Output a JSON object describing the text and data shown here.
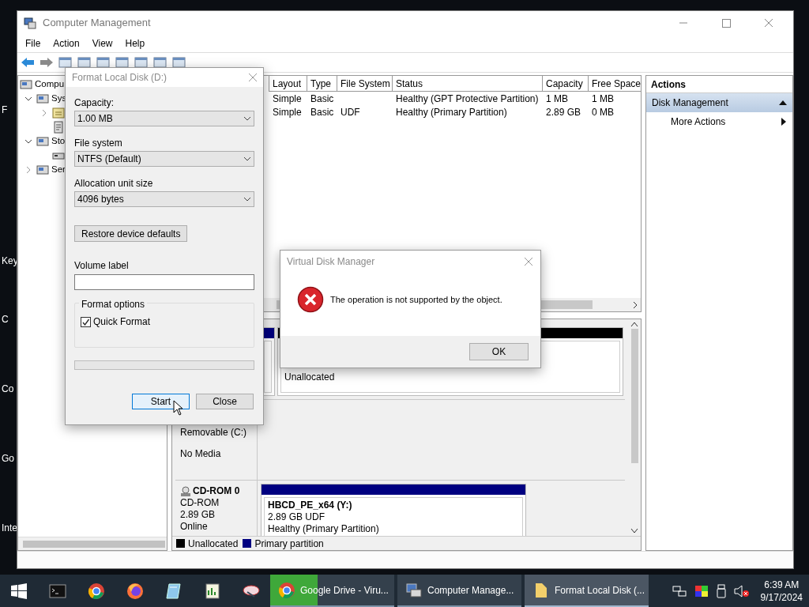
{
  "desktop_labels": [
    "F",
    "Key",
    "C",
    "Co",
    "Go",
    "Inte"
  ],
  "main_window": {
    "title": "Computer Management",
    "menu": [
      "File",
      "Action",
      "View",
      "Help"
    ],
    "tree": [
      {
        "label": "Compu",
        "children": [
          {
            "label": "Sys",
            "expanded": true,
            "children": [
              {
                "kind": "scheduler",
                "expanded": false
              },
              {
                "kind": "viewer"
              }
            ]
          },
          {
            "label": "Sto",
            "expanded": true,
            "children": [
              {
                "kind": "disk"
              }
            ]
          },
          {
            "label": "Ser",
            "expanded": false
          }
        ]
      }
    ],
    "table": {
      "columns": [
        "Layout",
        "Type",
        "File System",
        "Status",
        "Capacity",
        "Free Space"
      ],
      "rows": [
        [
          "Simple",
          "Basic",
          "",
          "Healthy (GPT Protective Partition)",
          "1 MB",
          "1 MB"
        ],
        [
          "Simple",
          "Basic",
          "UDF",
          "Healthy (Primary Partition)",
          "2.89 GB",
          "0 MB"
        ]
      ]
    },
    "disks": [
      {
        "partitions": [
          {
            "kind": "primary"
          },
          {
            "kind": "unallocated",
            "lines": [
              "Unallocated"
            ]
          }
        ]
      },
      {
        "lines": [
          "Removable (C:)",
          "No Media"
        ]
      },
      {
        "name": "CD-ROM 0",
        "lines": [
          "CD-ROM",
          "2.89 GB",
          "Online"
        ],
        "partitions": [
          {
            "kind": "primary",
            "title": "HBCD_PE_x64  (Y:)",
            "lines": [
              "2.89 GB UDF",
              "Healthy (Primary Partition)"
            ]
          }
        ]
      }
    ],
    "legend": [
      {
        "label": "Unallocated",
        "color": "#000000"
      },
      {
        "label": "Primary partition",
        "color": "#000080"
      }
    ],
    "actions": {
      "title": "Actions",
      "items": [
        {
          "label": "Disk Management",
          "kind": "section",
          "selected": true
        },
        {
          "label": "More Actions",
          "kind": "submenu",
          "selected": false
        }
      ]
    }
  },
  "format_dialog": {
    "title": "Format Local Disk (D:)",
    "fields": [
      {
        "label": "Capacity:",
        "value": "1.00 MB"
      },
      {
        "label": "File system",
        "value": "NTFS (Default)"
      },
      {
        "label": "Allocation unit size",
        "value": "4096 bytes"
      }
    ],
    "restore_button": "Restore device defaults",
    "volume_label": "Volume label",
    "options_title": "Format options",
    "quick_format": {
      "label": "Quick Format",
      "checked": true
    },
    "progress": {
      "level": 0
    },
    "buttons": [
      {
        "label": "Start",
        "default": true
      },
      {
        "label": "Close",
        "default": false
      }
    ]
  },
  "message_dialog": {
    "title": "Virtual Disk Manager",
    "message": "The operation is not supported by the object.",
    "button": "OK"
  },
  "taskbar": {
    "pinned": [
      {
        "kind": "terminal"
      },
      {
        "kind": "browser"
      },
      {
        "kind": "browser2"
      },
      {
        "kind": "notebook"
      },
      {
        "kind": "chart"
      },
      {
        "kind": "tool"
      }
    ],
    "windows": [
      {
        "label": "Google Drive - Viru...",
        "selected": false,
        "level": 0.38
      },
      {
        "label": "Computer Manage...",
        "selected": false
      },
      {
        "label": "Format Local Disk (...",
        "selected": true
      }
    ],
    "time": "6:39 AM",
    "date": "9/17/2024"
  }
}
